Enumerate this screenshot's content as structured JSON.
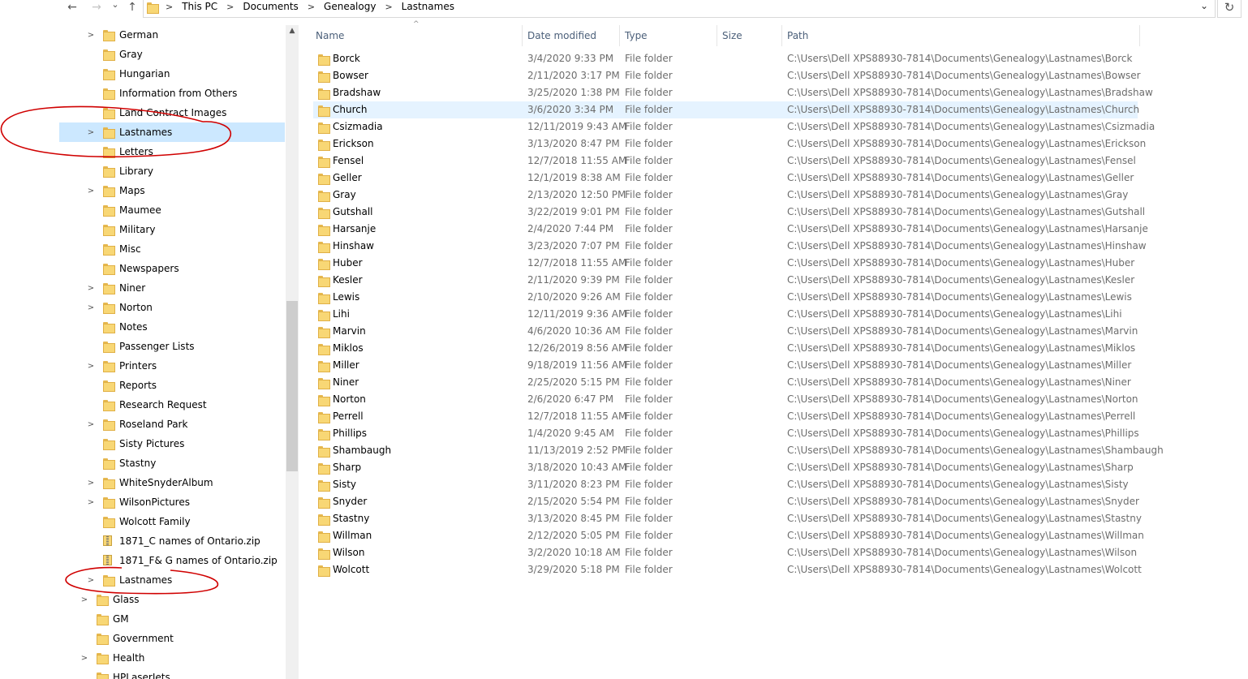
{
  "address": {
    "back_icon": "←",
    "forward_icon": "→",
    "recent_icon": "⌄",
    "up_icon": "↑",
    "crumbs": [
      "This PC",
      "Documents",
      "Genealogy",
      "Lastnames"
    ],
    "separator": ">",
    "dropdown_icon": "⌄",
    "refresh_icon": "↻"
  },
  "nav": {
    "scroll_up_icon": "▲",
    "items": [
      {
        "label": "German",
        "icon": "folder",
        "expand": true,
        "selected": false
      },
      {
        "label": "Gray",
        "icon": "folder",
        "expand": false,
        "selected": false
      },
      {
        "label": "Hungarian",
        "icon": "folder",
        "expand": false,
        "selected": false
      },
      {
        "label": "Information from Others",
        "icon": "folder",
        "expand": false,
        "selected": false
      },
      {
        "label": "Land Contract Images",
        "icon": "folder",
        "expand": false,
        "selected": false
      },
      {
        "label": "Lastnames",
        "icon": "folder",
        "expand": true,
        "selected": true
      },
      {
        "label": "Letters",
        "icon": "folder",
        "expand": false,
        "selected": false
      },
      {
        "label": "Library",
        "icon": "folder",
        "expand": false,
        "selected": false
      },
      {
        "label": "Maps",
        "icon": "folder",
        "expand": true,
        "selected": false
      },
      {
        "label": "Maumee",
        "icon": "folder",
        "expand": false,
        "selected": false
      },
      {
        "label": "Military",
        "icon": "folder",
        "expand": false,
        "selected": false
      },
      {
        "label": "Misc",
        "icon": "folder",
        "expand": false,
        "selected": false
      },
      {
        "label": "Newspapers",
        "icon": "folder",
        "expand": false,
        "selected": false
      },
      {
        "label": "Niner",
        "icon": "folder",
        "expand": true,
        "selected": false
      },
      {
        "label": "Norton",
        "icon": "folder",
        "expand": true,
        "selected": false
      },
      {
        "label": "Notes",
        "icon": "folder",
        "expand": false,
        "selected": false
      },
      {
        "label": "Passenger Lists",
        "icon": "folder",
        "expand": false,
        "selected": false
      },
      {
        "label": "Printers",
        "icon": "folder",
        "expand": true,
        "selected": false
      },
      {
        "label": "Reports",
        "icon": "folder",
        "expand": false,
        "selected": false
      },
      {
        "label": "Research Request",
        "icon": "folder",
        "expand": false,
        "selected": false
      },
      {
        "label": "Roseland Park",
        "icon": "folder",
        "expand": true,
        "selected": false
      },
      {
        "label": "Sisty Pictures",
        "icon": "folder",
        "expand": false,
        "selected": false
      },
      {
        "label": "Stastny",
        "icon": "folder",
        "expand": false,
        "selected": false
      },
      {
        "label": "WhiteSnyderAlbum",
        "icon": "folder",
        "expand": true,
        "selected": false
      },
      {
        "label": "WilsonPictures",
        "icon": "folder",
        "expand": true,
        "selected": false
      },
      {
        "label": "Wolcott Family",
        "icon": "folder",
        "expand": false,
        "selected": false
      },
      {
        "label": "1871_C names of Ontario.zip",
        "icon": "zip",
        "expand": false,
        "selected": false
      },
      {
        "label": "1871_F& G names of Ontario.zip",
        "icon": "zip",
        "expand": false,
        "selected": false
      },
      {
        "label": "Lastnames",
        "icon": "folder",
        "expand": true,
        "selected": false,
        "level": 1
      },
      {
        "label": "Glass",
        "icon": "folder",
        "expand": true,
        "selected": false,
        "level": 0
      },
      {
        "label": "GM",
        "icon": "folder",
        "expand": false,
        "selected": false,
        "level": 0
      },
      {
        "label": "Government",
        "icon": "folder",
        "expand": false,
        "selected": false,
        "level": 0
      },
      {
        "label": "Health",
        "icon": "folder",
        "expand": true,
        "selected": false,
        "level": 0
      },
      {
        "label": "HPLaserJets",
        "icon": "folder",
        "expand": false,
        "selected": false,
        "level": 0
      }
    ]
  },
  "list": {
    "columns": [
      "Name",
      "Date modified",
      "Type",
      "Size",
      "Path"
    ],
    "sort_icon": "^",
    "highlighted_row": 3,
    "rows": [
      {
        "name": "Borck",
        "date": "3/4/2020 9:33 PM",
        "type": "File folder",
        "path": "C:\\Users\\Dell XPS88930-7814\\Documents\\Genealogy\\Lastnames\\Borck"
      },
      {
        "name": "Bowser",
        "date": "2/11/2020 3:17 PM",
        "type": "File folder",
        "path": "C:\\Users\\Dell XPS88930-7814\\Documents\\Genealogy\\Lastnames\\Bowser"
      },
      {
        "name": "Bradshaw",
        "date": "3/25/2020 1:38 PM",
        "type": "File folder",
        "path": "C:\\Users\\Dell XPS88930-7814\\Documents\\Genealogy\\Lastnames\\Bradshaw"
      },
      {
        "name": "Church",
        "date": "3/6/2020 3:34 PM",
        "type": "File folder",
        "path": "C:\\Users\\Dell XPS88930-7814\\Documents\\Genealogy\\Lastnames\\Church"
      },
      {
        "name": "Csizmadia",
        "date": "12/11/2019 9:43 AM",
        "type": "File folder",
        "path": "C:\\Users\\Dell XPS88930-7814\\Documents\\Genealogy\\Lastnames\\Csizmadia"
      },
      {
        "name": "Erickson",
        "date": "3/13/2020 8:47 PM",
        "type": "File folder",
        "path": "C:\\Users\\Dell XPS88930-7814\\Documents\\Genealogy\\Lastnames\\Erickson"
      },
      {
        "name": "Fensel",
        "date": "12/7/2018 11:55 AM",
        "type": "File folder",
        "path": "C:\\Users\\Dell XPS88930-7814\\Documents\\Genealogy\\Lastnames\\Fensel"
      },
      {
        "name": "Geller",
        "date": "12/1/2019 8:38 AM",
        "type": "File folder",
        "path": "C:\\Users\\Dell XPS88930-7814\\Documents\\Genealogy\\Lastnames\\Geller"
      },
      {
        "name": "Gray",
        "date": "2/13/2020 12:50 PM",
        "type": "File folder",
        "path": "C:\\Users\\Dell XPS88930-7814\\Documents\\Genealogy\\Lastnames\\Gray"
      },
      {
        "name": "Gutshall",
        "date": "3/22/2019 9:01 PM",
        "type": "File folder",
        "path": "C:\\Users\\Dell XPS88930-7814\\Documents\\Genealogy\\Lastnames\\Gutshall"
      },
      {
        "name": "Harsanje",
        "date": "2/4/2020 7:44 PM",
        "type": "File folder",
        "path": "C:\\Users\\Dell XPS88930-7814\\Documents\\Genealogy\\Lastnames\\Harsanje"
      },
      {
        "name": "Hinshaw",
        "date": "3/23/2020 7:07 PM",
        "type": "File folder",
        "path": "C:\\Users\\Dell XPS88930-7814\\Documents\\Genealogy\\Lastnames\\Hinshaw"
      },
      {
        "name": "Huber",
        "date": "12/7/2018 11:55 AM",
        "type": "File folder",
        "path": "C:\\Users\\Dell XPS88930-7814\\Documents\\Genealogy\\Lastnames\\Huber"
      },
      {
        "name": "Kesler",
        "date": "2/11/2020 9:39 PM",
        "type": "File folder",
        "path": "C:\\Users\\Dell XPS88930-7814\\Documents\\Genealogy\\Lastnames\\Kesler"
      },
      {
        "name": "Lewis",
        "date": "2/10/2020 9:26 AM",
        "type": "File folder",
        "path": "C:\\Users\\Dell XPS88930-7814\\Documents\\Genealogy\\Lastnames\\Lewis"
      },
      {
        "name": "Lihi",
        "date": "12/11/2019 9:36 AM",
        "type": "File folder",
        "path": "C:\\Users\\Dell XPS88930-7814\\Documents\\Genealogy\\Lastnames\\Lihi"
      },
      {
        "name": "Marvin",
        "date": "4/6/2020 10:36 AM",
        "type": "File folder",
        "path": "C:\\Users\\Dell XPS88930-7814\\Documents\\Genealogy\\Lastnames\\Marvin"
      },
      {
        "name": "Miklos",
        "date": "12/26/2019 8:56 AM",
        "type": "File folder",
        "path": "C:\\Users\\Dell XPS88930-7814\\Documents\\Genealogy\\Lastnames\\Miklos"
      },
      {
        "name": "Miller",
        "date": "9/18/2019 11:56 AM",
        "type": "File folder",
        "path": "C:\\Users\\Dell XPS88930-7814\\Documents\\Genealogy\\Lastnames\\Miller"
      },
      {
        "name": "Niner",
        "date": "2/25/2020 5:15 PM",
        "type": "File folder",
        "path": "C:\\Users\\Dell XPS88930-7814\\Documents\\Genealogy\\Lastnames\\Niner"
      },
      {
        "name": "Norton",
        "date": "2/6/2020 6:47 PM",
        "type": "File folder",
        "path": "C:\\Users\\Dell XPS88930-7814\\Documents\\Genealogy\\Lastnames\\Norton"
      },
      {
        "name": "Perrell",
        "date": "12/7/2018 11:55 AM",
        "type": "File folder",
        "path": "C:\\Users\\Dell XPS88930-7814\\Documents\\Genealogy\\Lastnames\\Perrell"
      },
      {
        "name": "Phillips",
        "date": "1/4/2020 9:45 AM",
        "type": "File folder",
        "path": "C:\\Users\\Dell XPS88930-7814\\Documents\\Genealogy\\Lastnames\\Phillips"
      },
      {
        "name": "Shambaugh",
        "date": "11/13/2019 2:52 PM",
        "type": "File folder",
        "path": "C:\\Users\\Dell XPS88930-7814\\Documents\\Genealogy\\Lastnames\\Shambaugh"
      },
      {
        "name": "Sharp",
        "date": "3/18/2020 10:43 AM",
        "type": "File folder",
        "path": "C:\\Users\\Dell XPS88930-7814\\Documents\\Genealogy\\Lastnames\\Sharp"
      },
      {
        "name": "Sisty",
        "date": "3/11/2020 8:23 PM",
        "type": "File folder",
        "path": "C:\\Users\\Dell XPS88930-7814\\Documents\\Genealogy\\Lastnames\\Sisty"
      },
      {
        "name": "Snyder",
        "date": "2/15/2020 5:54 PM",
        "type": "File folder",
        "path": "C:\\Users\\Dell XPS88930-7814\\Documents\\Genealogy\\Lastnames\\Snyder"
      },
      {
        "name": "Stastny",
        "date": "3/13/2020 8:45 PM",
        "type": "File folder",
        "path": "C:\\Users\\Dell XPS88930-7814\\Documents\\Genealogy\\Lastnames\\Stastny"
      },
      {
        "name": "Willman",
        "date": "2/12/2020 5:05 PM",
        "type": "File folder",
        "path": "C:\\Users\\Dell XPS88930-7814\\Documents\\Genealogy\\Lastnames\\Willman"
      },
      {
        "name": "Wilson",
        "date": "3/2/2020 10:18 AM",
        "type": "File folder",
        "path": "C:\\Users\\Dell XPS88930-7814\\Documents\\Genealogy\\Lastnames\\Wilson"
      },
      {
        "name": "Wolcott",
        "date": "3/29/2020 5:18 PM",
        "type": "File folder",
        "path": "C:\\Users\\Dell XPS88930-7814\\Documents\\Genealogy\\Lastnames\\Wolcott"
      }
    ]
  },
  "colors": {
    "selection": "#cce8ff",
    "hover": "#e5f3ff",
    "annotation": "#d00000",
    "folder": "#f8d775"
  }
}
